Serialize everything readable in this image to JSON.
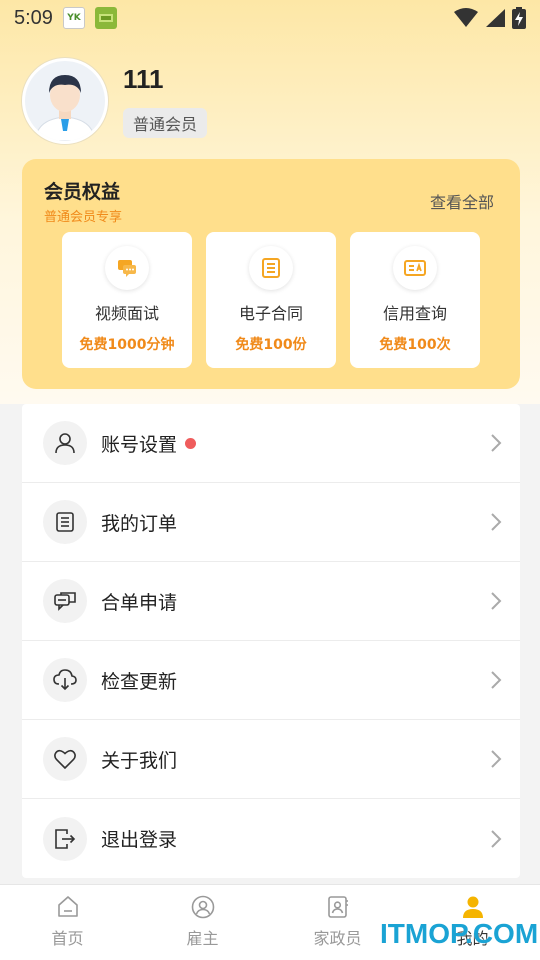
{
  "status_bar": {
    "time": "5:09",
    "notification_icons": [
      "app-notification-icon",
      "game-notification-icon"
    ],
    "icons": [
      "wifi-icon",
      "signal-icon",
      "battery-charging-icon"
    ]
  },
  "profile": {
    "username": "111",
    "member_level": "普通会员"
  },
  "benefits": {
    "title": "会员权益",
    "subtitle": "普通会员专享",
    "view_all": "查看全部",
    "items": [
      {
        "name": "视频面试",
        "desc": "免费1000分钟",
        "icon": "video-chat-icon"
      },
      {
        "name": "电子合同",
        "desc": "免费100份",
        "icon": "contract-icon"
      },
      {
        "name": "信用查询",
        "desc": "免费100次",
        "icon": "credit-card-icon"
      }
    ]
  },
  "menu": [
    {
      "label": "账号设置",
      "icon": "user-icon",
      "badge": true
    },
    {
      "label": "我的订单",
      "icon": "order-list-icon",
      "badge": false
    },
    {
      "label": "合单申请",
      "icon": "chat-request-icon",
      "badge": false
    },
    {
      "label": "检查更新",
      "icon": "cloud-download-icon",
      "badge": false
    },
    {
      "label": "关于我们",
      "icon": "heart-icon",
      "badge": false
    },
    {
      "label": "退出登录",
      "icon": "logout-icon",
      "badge": false
    }
  ],
  "bottom_nav": [
    {
      "label": "首页",
      "icon": "home-icon",
      "active": false
    },
    {
      "label": "雇主",
      "icon": "employer-icon",
      "active": false
    },
    {
      "label": "家政员",
      "icon": "housekeeper-icon",
      "active": false
    },
    {
      "label": "我的",
      "icon": "profile-icon",
      "active": true
    }
  ],
  "watermark": "ITMOP.COM",
  "colors": {
    "accent": "#f5a623",
    "orange_text": "#f08a1a",
    "card_bg": "#ffdf8c",
    "red_dot": "#ef5c5c"
  }
}
